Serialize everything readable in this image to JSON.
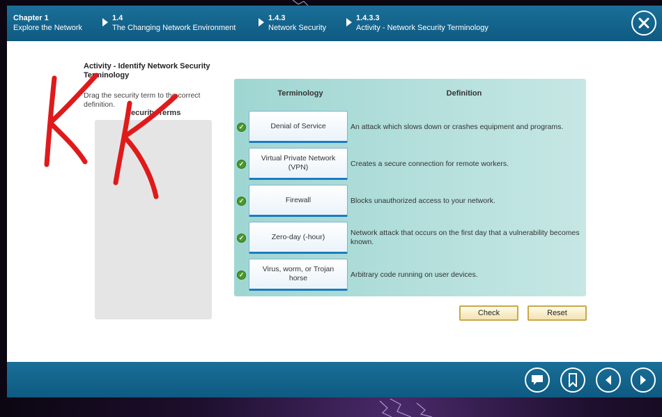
{
  "breadcrumbs": [
    {
      "num": "Chapter 1",
      "label": "Explore the Network"
    },
    {
      "num": "1.4",
      "label": "The Changing Network Environment"
    },
    {
      "num": "1.4.3",
      "label": "Network Security"
    },
    {
      "num": "1.4.3.3",
      "label": "Activity - Network Security Terminology"
    }
  ],
  "activity": {
    "title": "Activity - Identify Network Security Terminology",
    "instructions": "Drag the security term to the correct definition.",
    "terms_heading": "Security Terms"
  },
  "table": {
    "header_term": "Terminology",
    "header_definition": "Definition",
    "rows": [
      {
        "term": "Denial of Service",
        "definition": "An attack which slows down or crashes equipment and programs.",
        "correct": true
      },
      {
        "term": "Virtual Private Network (VPN)",
        "definition": "Creates a secure connection for remote workers.",
        "correct": true
      },
      {
        "term": "Firewall",
        "definition": "Blocks unauthorized access to your network.",
        "correct": true
      },
      {
        "term": "Zero-day (-hour)",
        "definition": "Network attack that occurs on the first day that a vulnerability becomes known.",
        "correct": true
      },
      {
        "term": "Virus, worm, or Trojan horse",
        "definition": "Arbitrary code running on user devices.",
        "correct": true
      }
    ]
  },
  "buttons": {
    "check": "Check",
    "reset": "Reset"
  },
  "icons": {
    "close": "close-icon",
    "comment": "comment-icon",
    "bookmark": "bookmark-icon",
    "back": "back-icon",
    "forward": "forward-icon",
    "check": "checkmark-icon"
  },
  "colors": {
    "bar": "#0e5a82",
    "panel": "#9fd6d2",
    "correct": "#4a9a2a",
    "annotation": "#e01a1a"
  }
}
